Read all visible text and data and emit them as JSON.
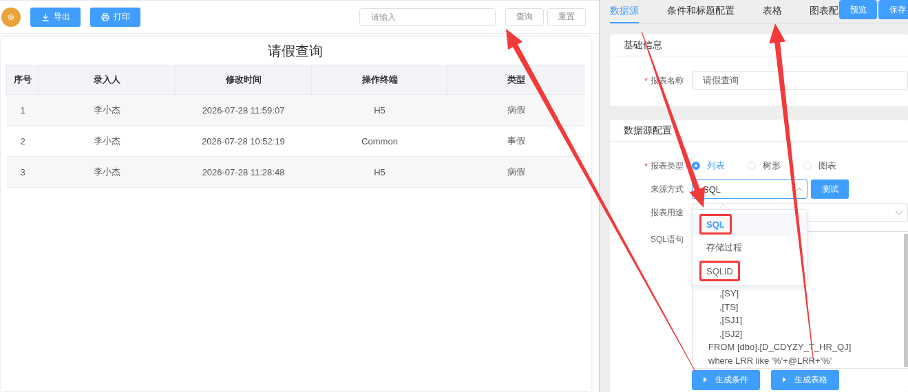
{
  "toolbar": {
    "buttons": [
      {
        "label": "导出"
      },
      {
        "label": "打印"
      }
    ],
    "search": {
      "placeholder": "请输入"
    },
    "actions": [
      "查询",
      "重置"
    ]
  },
  "report": {
    "title": "请假查询",
    "columns": [
      "序号",
      "录入人",
      "修改时间",
      "操作终端",
      "类型"
    ],
    "rows": [
      {
        "cells": [
          "1",
          "李小杰",
          "2026-07-28 11:59:07",
          "H5",
          "病假"
        ]
      },
      {
        "cells": [
          "2",
          "李小杰",
          "2026-07-28 10:52:19",
          "Common",
          "事假"
        ]
      },
      {
        "cells": [
          "3",
          "李小杰",
          "2026-07-28 11:28:48",
          "H5",
          "病假"
        ]
      }
    ]
  },
  "config": {
    "tabs": [
      {
        "label": "数据源",
        "selected": true
      },
      {
        "label": "条件和标题配置",
        "selected": false
      },
      {
        "label": "表格",
        "selected": false
      },
      {
        "label": "图表配",
        "selected": false
      }
    ],
    "top_buttons": [
      "预览",
      "保存"
    ],
    "basic": {
      "title": "基础信息",
      "field": {
        "label": "报表名称",
        "required_mark": "*",
        "value": "请假查询"
      }
    },
    "datasource": {
      "title": "数据源配置",
      "report_type": {
        "label": "报表类型",
        "required_mark": "*",
        "options": [
          {
            "label": "列表",
            "selected": true
          },
          {
            "label": "树形",
            "selected": false
          },
          {
            "label": "图表",
            "selected": false
          }
        ]
      },
      "source": {
        "label": "来源方式",
        "value": "SQL",
        "expanded": true,
        "test_button": "测试",
        "options": [
          {
            "label": "SQL",
            "selected": true,
            "highlighted": true
          },
          {
            "label": "存储过程",
            "selected": false,
            "highlighted": false
          },
          {
            "label": "SQLID",
            "selected": false,
            "highlighted": true
          }
        ]
      },
      "usage": {
        "label": "报表用途"
      },
      "sql": {
        "label": "SQL语句",
        "lines": [
          {
            "text": ",[SY]",
            "indent": true
          },
          {
            "text": ",[TS]",
            "indent": true
          },
          {
            "text": ",[SJ1]",
            "indent": true
          },
          {
            "text": ",[SJ2]",
            "indent": true
          },
          {
            "text": "FROM [dbo].[D_CDYZY_T_HR_QJ]",
            "indent": false
          },
          {
            "text": "where LRR like '%'+@LRR+'%'",
            "indent": false
          }
        ]
      },
      "buttons": [
        "生成条件",
        "生成表格"
      ]
    }
  },
  "annotations": [
    {
      "kind": "arrow"
    },
    {
      "kind": "arrow"
    },
    {
      "kind": "arrow"
    }
  ]
}
